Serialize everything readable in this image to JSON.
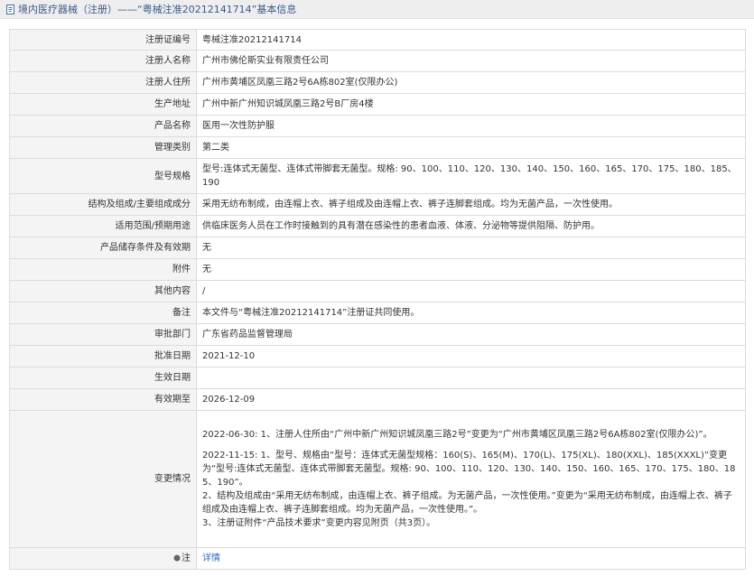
{
  "header": {
    "title": "境内医疗器械（注册）——“粤械注准20212141714”基本信息"
  },
  "rows": [
    {
      "label": "注册证编号",
      "value": "粤械注准20212141714"
    },
    {
      "label": "注册人名称",
      "value": "广州市佛伦斯实业有限责任公司"
    },
    {
      "label": "注册人住所",
      "value": "广州市黄埔区凤凰三路2号6A栋802室(仅限办公)"
    },
    {
      "label": "生产地址",
      "value": "广州中新广州知识城凤凰三路2号B厂房4楼"
    },
    {
      "label": "产品名称",
      "value": "医用一次性防护服"
    },
    {
      "label": "管理类别",
      "value": "第二类"
    },
    {
      "label": "型号规格",
      "value": "型号:连体式无菌型、连体式带脚套无菌型。规格: 90、100、110、120、130、140、150、160、165、170、175、180、185、190"
    },
    {
      "label": "结构及组成/主要组成成分",
      "value": "采用无纺布制成，由连帽上衣、裤子组成及由连帽上衣、裤子连脚套组成。均为无菌产品，一次性使用。"
    },
    {
      "label": "适用范围/预期用途",
      "value": "供临床医务人员在工作时接触到的具有潜在感染性的患者血液、体液、分泌物等提供阻隔、防护用。"
    },
    {
      "label": "产品储存条件及有效期",
      "value": "无"
    },
    {
      "label": "附件",
      "value": "无"
    },
    {
      "label": "其他内容",
      "value": "/"
    },
    {
      "label": "备注",
      "value": "本文件与“粤械注准20212141714”注册证共同使用。"
    },
    {
      "label": "审批部门",
      "value": "广东省药品监督管理局"
    },
    {
      "label": "批准日期",
      "value": "2021-12-10"
    },
    {
      "label": "生效日期",
      "value": ""
    },
    {
      "label": "有效期至",
      "value": "2026-12-09"
    }
  ],
  "changes": {
    "label": "变更情况",
    "entry1": "2022-06-30: 1、注册人住所由“广州中新广州知识城凤凰三路2号”变更为“广州市黄埔区凤凰三路2号6A栋802室(仅限办公)”。",
    "entry2_line1": "2022-11-15: 1、型号、规格由“型号：连体式无菌型规格：160(S)、165(M)、170(L)、175(XL)、180(XXL)、185(XXXL)”变更为“型号:连体式无菌型、连体式带脚套无菌型。规格: 90、100、110、120、130、140、150、160、165、170、175、180、185、190”。",
    "entry2_line2": "2、结构及组成由“采用无纺布制成，由连帽上衣、裤子组成。为无菌产品，一次性使用。”变更为“采用无纺布制成，由连帽上衣、裤子组成及由连帽上衣、裤子连脚套组成。均为无菌产品，一次性使用。”。",
    "entry2_line3": "3、注册证附件“产品技术要求”变更内容见附页（共3页）。"
  },
  "note": {
    "label": "注",
    "link": "详情"
  },
  "colors": {
    "title_text": "#3a5a8c",
    "label_bg": "#f4f4f4",
    "border": "#dcdcdc",
    "link": "#2a6ac4"
  }
}
